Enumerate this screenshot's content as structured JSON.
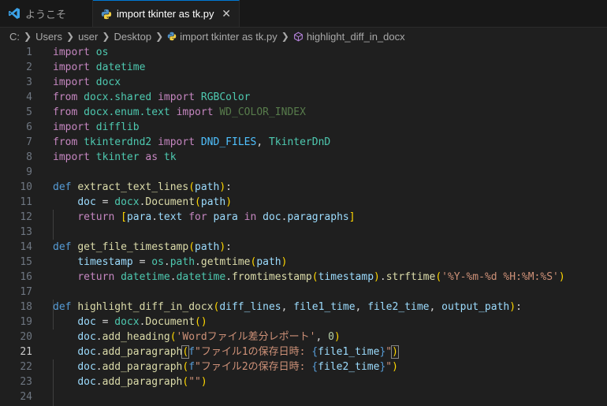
{
  "tabs": [
    {
      "label": "ようこそ",
      "active": false
    },
    {
      "label": "import tkinter as tk.py",
      "active": true
    }
  ],
  "breadcrumb": [
    "C:",
    "Users",
    "user",
    "Desktop",
    "import tkinter as tk.py",
    "highlight_diff_in_docx"
  ],
  "current_line": 21,
  "line_numbers": [
    "1",
    "2",
    "3",
    "4",
    "5",
    "6",
    "7",
    "8",
    "9",
    "10",
    "11",
    "12",
    "13",
    "14",
    "15",
    "16",
    "17",
    "18",
    "19",
    "20",
    "21",
    "22",
    "23",
    "24"
  ],
  "code": {
    "l1": {
      "kw": "import",
      "a": "os"
    },
    "l2": {
      "kw": "import",
      "a": "datetime"
    },
    "l3": {
      "kw": "import",
      "a": "docx"
    },
    "l4": {
      "kw1": "from",
      "a": "docx",
      "b": ".shared",
      "kw2": "import",
      "c": "RGBColor"
    },
    "l5": {
      "kw1": "from",
      "a": "docx",
      "b": ".enum.text",
      "kw2": "import",
      "c": "WD_COLOR_INDEX"
    },
    "l6": {
      "kw": "import",
      "a": "difflib"
    },
    "l7": {
      "kw1": "from",
      "a": "tkinterdnd2",
      "kw2": "import",
      "c": "DND_FILES",
      "d": "TkinterDnD"
    },
    "l8": {
      "kw": "import",
      "a": "tkinter",
      "kw2": "as",
      "b": "tk"
    },
    "l10": {
      "def": "def",
      "fn": "extract_text_lines",
      "p": "path"
    },
    "l11": {
      "v": "doc",
      "m": "docx",
      "fn": "Document",
      "p": "path"
    },
    "l12": {
      "ret": "return",
      "a": "para",
      "b": "text",
      "for": "for",
      "c": "para",
      "in": "in",
      "d": "doc",
      "e": "paragraphs"
    },
    "l14": {
      "def": "def",
      "fn": "get_file_timestamp",
      "p": "path"
    },
    "l15": {
      "v": "timestamp",
      "m": "os",
      "b": "path",
      "fn": "getmtime",
      "p": "path"
    },
    "l16": {
      "ret": "return",
      "m": "datetime",
      "c": "datetime",
      "fn": "fromtimestamp",
      "p": "timestamp",
      "fn2": "strftime",
      "s": "'%Y-%m-%d %H:%M:%S'"
    },
    "l18": {
      "def": "def",
      "fn": "highlight_diff_in_docx",
      "p1": "diff_lines",
      "p2": "file1_time",
      "p3": "file2_time",
      "p4": "output_path"
    },
    "l19": {
      "v": "doc",
      "m": "docx",
      "fn": "Document"
    },
    "l20": {
      "v": "doc",
      "fn": "add_heading",
      "s": "'Wordファイル差分レポート'",
      "n": "0"
    },
    "l21": {
      "v": "doc",
      "fn": "add_paragraph",
      "f": "f",
      "s1": "\"ファイル1の保存日時: ",
      "e": "file1_time",
      "s2": "\""
    },
    "l22": {
      "v": "doc",
      "fn": "add_paragraph",
      "f": "f",
      "s1": "\"ファイル2の保存日時: ",
      "e": "file2_time",
      "s2": "\""
    },
    "l23": {
      "v": "doc",
      "fn": "add_paragraph",
      "s": "\"\""
    }
  }
}
